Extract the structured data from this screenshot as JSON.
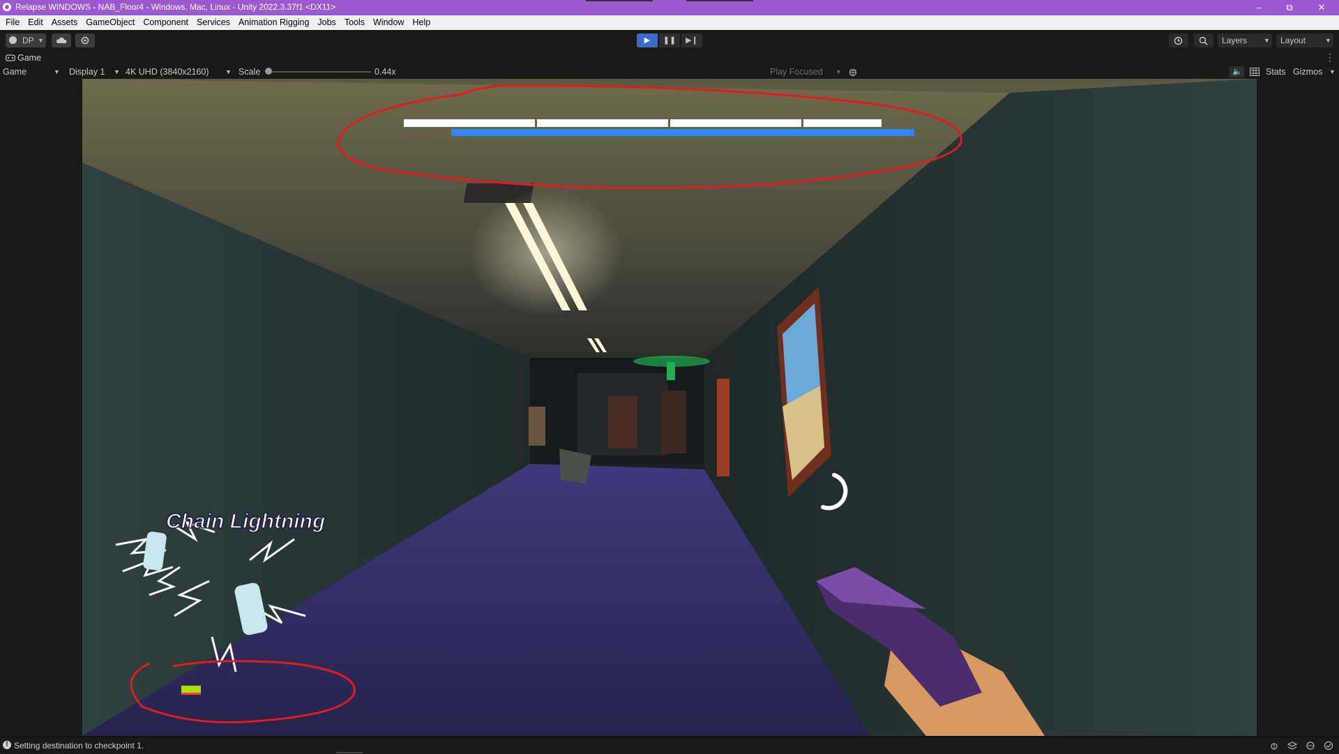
{
  "window": {
    "title": "Relapse WINDOWS - NAB_Floor4 - Windows, Mac, Linux - Unity 2022.3.37f1 <DX11>",
    "controls": [
      "minimize-icon",
      "restore-icon",
      "close-icon"
    ]
  },
  "menubar": {
    "items": [
      "File",
      "Edit",
      "Assets",
      "GameObject",
      "Component",
      "Services",
      "Animation Rigging",
      "Jobs",
      "Tools",
      "Window",
      "Help"
    ]
  },
  "toolbar": {
    "account_label": "DP",
    "layers_label": "Layers",
    "layout_label": "Layout",
    "play_state": "playing"
  },
  "game_view": {
    "tab_label": "Game",
    "view_select": "Game",
    "display_select": "Display 1",
    "resolution_select": "4K UHD (3840x2160)",
    "scale_label": "Scale",
    "scale_value": "0.44x",
    "scale_fraction": 0.0,
    "play_mode_select": "Play Focused",
    "stats_label": "Stats",
    "gizmos_label": "Gizmos"
  },
  "hud": {
    "ability_name": "Chain Lightning",
    "boss_health_segments": 4,
    "colors": {
      "annotation": "#e01c1c",
      "health_fill": "#ffffff",
      "shield_bar": "#2f88ff",
      "stamina_green": "#a6e400",
      "stamina_red": "#ff3b3b",
      "floor": "#3b3577",
      "wall": "#2a3a38",
      "exit_sign": "#22ff66"
    }
  },
  "statusbar": {
    "message": "Setting destination to checkpoint 1."
  },
  "accent": {
    "titlebar": "#9b59d0",
    "play_active": "#3c6ccc"
  }
}
